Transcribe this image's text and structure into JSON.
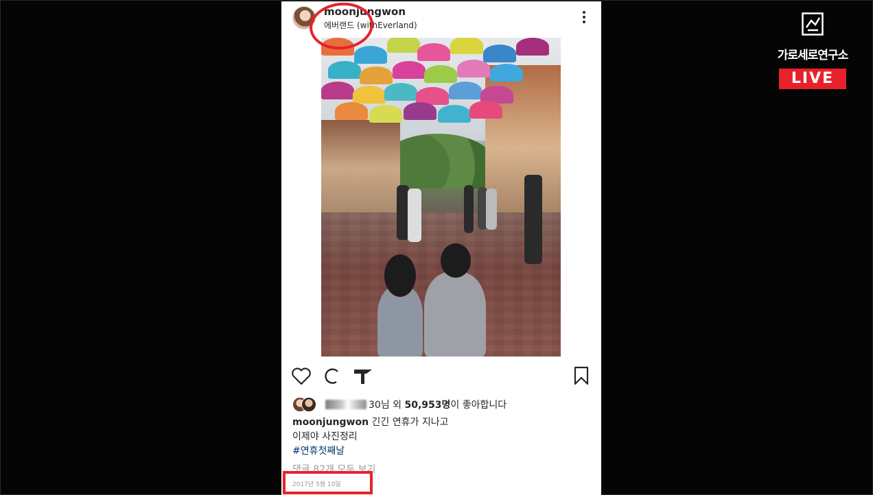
{
  "post": {
    "username": "moonjungwon",
    "location": "에버랜드 (withEverland)",
    "likes_suffix": "30님 외",
    "likes_count": "50,953명",
    "likes_end": "이 좋아합니다",
    "caption_user": "moonjungwon",
    "caption_line1": "긴긴 연휴가 지나고",
    "caption_line2": "이제야 사진정리",
    "hashtag": "#연휴첫째날",
    "view_comments": "댓글 82개 모두 보기",
    "date": "2017년 5월 10일"
  },
  "channel": {
    "name": "가로세로연구소",
    "live": "LIVE"
  },
  "colors": {
    "annotation": "#e8222c",
    "hashtag": "#003569",
    "muted": "#999999"
  },
  "icons": [
    "more-icon",
    "heart-icon",
    "comment-icon",
    "share-icon",
    "bookmark-icon",
    "logo-icon"
  ]
}
